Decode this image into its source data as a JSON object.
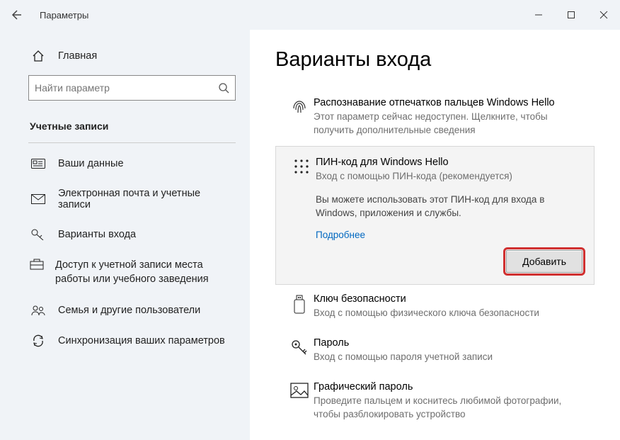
{
  "titlebar": {
    "title": "Параметры"
  },
  "sidebar": {
    "home": "Главная",
    "search_placeholder": "Найти параметр",
    "category": "Учетные записи",
    "items": [
      {
        "label": "Ваши данные"
      },
      {
        "label": "Электронная почта и учетные записи"
      },
      {
        "label": "Варианты входа"
      },
      {
        "label": "Доступ к учетной записи места работы или учебного заведения"
      },
      {
        "label": "Семья и другие пользователи"
      },
      {
        "label": "Синхронизация ваших параметров"
      }
    ]
  },
  "main": {
    "title": "Варианты входа",
    "options": [
      {
        "title": "Распознавание отпечатков пальцев Windows Hello",
        "sub": "Этот параметр сейчас недоступен. Щелкните, чтобы получить дополнительные сведения"
      },
      {
        "title": "ПИН-код для Windows Hello",
        "sub": "Вход с помощью ПИН-кода (рекомендуется)",
        "desc": "Вы можете использовать этот ПИН-код для входа в Windows, приложения и службы.",
        "more": "Подробнее",
        "action": "Добавить"
      },
      {
        "title": "Ключ безопасности",
        "sub": "Вход с помощью физического ключа безопасности"
      },
      {
        "title": "Пароль",
        "sub": "Вход с помощью пароля учетной записи"
      },
      {
        "title": "Графический пароль",
        "sub": "Проведите пальцем и коснитесь любимой фотографии, чтобы разблокировать устройство"
      }
    ]
  }
}
